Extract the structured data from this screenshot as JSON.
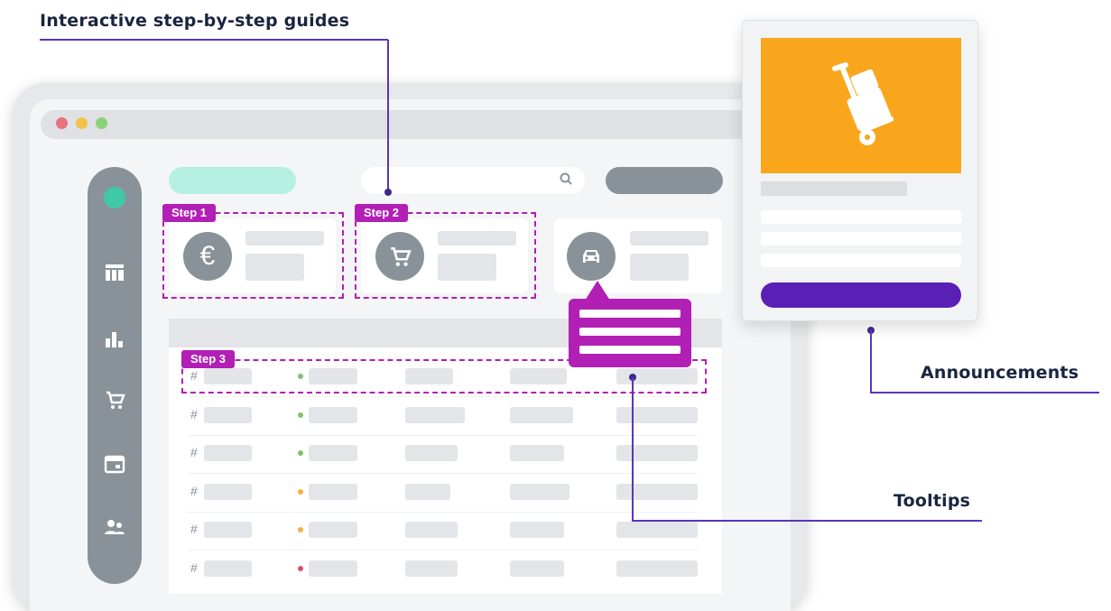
{
  "callouts": {
    "guides": "Interactive step-by-step guides",
    "announcements": "Announcements",
    "tooltips": "Tooltips"
  },
  "steps": [
    "Step 1",
    "Step 2",
    "Step 3"
  ],
  "cards": [
    {
      "icon": "euro-icon",
      "glyph": "€"
    },
    {
      "icon": "cart-icon",
      "glyph": "🛒"
    },
    {
      "icon": "car-icon",
      "glyph": "🚗"
    }
  ],
  "sidebar_icons": [
    "table-icon",
    "bar-chart-icon",
    "cart-icon",
    "calendar-icon",
    "users-icon"
  ],
  "table": {
    "row_marker": "#",
    "status_colors": [
      "#7ec46a",
      "#7ec46a",
      "#7ec46a",
      "#f3b23f",
      "#f3b23f",
      "#d9546b"
    ]
  },
  "colors": {
    "accent": "#b21fb5",
    "line": "#5b35b5",
    "announcement_banner": "#f9a61d",
    "announcement_button": "#5a1fb5",
    "mint_pill": "#b6f0e2",
    "gray": "#8a9299"
  }
}
